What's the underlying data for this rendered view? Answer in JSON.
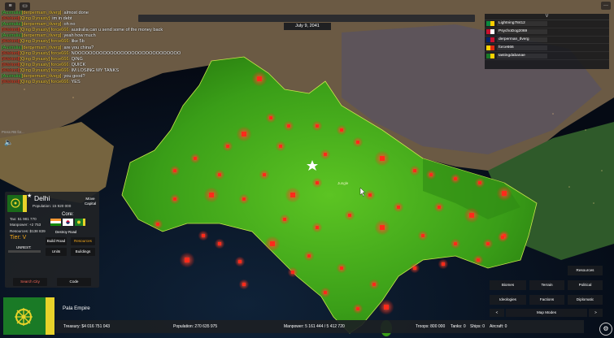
{
  "chat": [
    {
      "tag": "[Australia]",
      "tagClass": "tag-au",
      "user": "[derpermam_tlverg]:",
      "msg": "almost done"
    },
    {
      "tag": "[Warlord]",
      "tagClass": "tag-wl",
      "user": "[Qing Dynasty]:",
      "msg": "im in debt"
    },
    {
      "tag": "[Australia]",
      "tagClass": "tag-au",
      "user": "[derpermam_tlverg]:",
      "msg": "oh no"
    },
    {
      "tag": "[Warlord]",
      "tagClass": "tag-wl",
      "user": "[Qing Dynasty] force666:",
      "msg": "australia can u send some of the money back"
    },
    {
      "tag": "[Australia]",
      "tagClass": "tag-au",
      "user": "[derpermam_tlverg]:",
      "msg": "yeah how much"
    },
    {
      "tag": "[Warlord]",
      "tagClass": "tag-wl",
      "user": "[Qing Dynasty] force666:",
      "msg": "like 5b"
    },
    {
      "tag": "[Australia]",
      "tagClass": "tag-au",
      "user": "[derpermam_tlverg]:",
      "msg": "are you china?"
    },
    {
      "tag": "[Warlord]",
      "tagClass": "tag-wl",
      "user": "[Qing Dynasty] force666:",
      "msg": "NOOOOOOOOOOOOOOOOOOOOOOOOOOOOOO"
    },
    {
      "tag": "[Warlord]",
      "tagClass": "tag-wl",
      "user": "[Qing Dynasty] force666:",
      "msg": "QING"
    },
    {
      "tag": "[Warlord]",
      "tagClass": "tag-wl",
      "user": "[Qing Dynasty] force666:",
      "msg": "QUICK"
    },
    {
      "tag": "[Warlord]",
      "tagClass": "tag-wl",
      "user": "[Qing Dynasty] force666:",
      "msg": "IM LOSING MY TANKS"
    },
    {
      "tag": "[Australia]",
      "tagClass": "tag-au",
      "user": "[derpermam_tlverg]:",
      "msg": "you good?"
    },
    {
      "tag": "[Warlord]",
      "tagClass": "tag-wl",
      "user": "[Qing Dynasty] force666:",
      "msg": "YES"
    }
  ],
  "ping": "Press RB  for...",
  "date": "July 9, 2041",
  "players_header": "V",
  "players": [
    {
      "name": "Lightning78412",
      "flag1": "#0a8a3c",
      "flag2": "#ffce00"
    },
    {
      "name": "PsychoDog2069",
      "flag1": "#c8102e",
      "flag2": "#ffffff"
    },
    {
      "name": "derperman_tlverg",
      "flag1": "#012169",
      "flag2": "#c8102e"
    },
    {
      "name": "force666",
      "flag1": "#ffd200",
      "flag2": "#de2910"
    },
    {
      "name": "tastingdabanae",
      "flag1": "#1a7a26",
      "flag2": "#ffd200"
    }
  ],
  "map_labels": {
    "jungle": "Jungle"
  },
  "city": {
    "name": "Delhi",
    "population": "Population: 15 920 000",
    "move_capital": "Move Capital",
    "tax": "Tax: 51 981 770",
    "manpower": "Manpower: +2 753",
    "resources": "Resources: $138 839",
    "core_label": "Core:",
    "destroy_road": "Destroy Road",
    "tier": "Tier: V",
    "unrest": "UNREST:",
    "build_road": "Build Road",
    "resources_btn": "Resources",
    "units": "Units",
    "buildings": "Buildings",
    "search_city": "Search City",
    "code": "Code"
  },
  "nation": {
    "name": "Pala Empire"
  },
  "bottom": {
    "treasury": "Treasury:  $4 016 751 043",
    "population": "Population: 270 635 975",
    "manpower": "Manpower:  5 161 444  /  5 412 720",
    "troops": "Troops: 800 000",
    "tanks": "Tanks: 0",
    "ships": "Ships: 0",
    "aircraft": "Aircraft: 0"
  },
  "mapmodes": {
    "resources": "Resources",
    "biomes": "Biomes",
    "terrain": "Terrain",
    "political": "Political",
    "ideologies": "Ideologies",
    "factions": "Factions",
    "diplomatic": "Diplomatic",
    "prev": "<",
    "title": "Map Modes",
    "next": ">"
  },
  "colors": {
    "accent_orange": "#f4a81c",
    "region_green": "#3fa818",
    "city_red": "#ff2a1a"
  }
}
